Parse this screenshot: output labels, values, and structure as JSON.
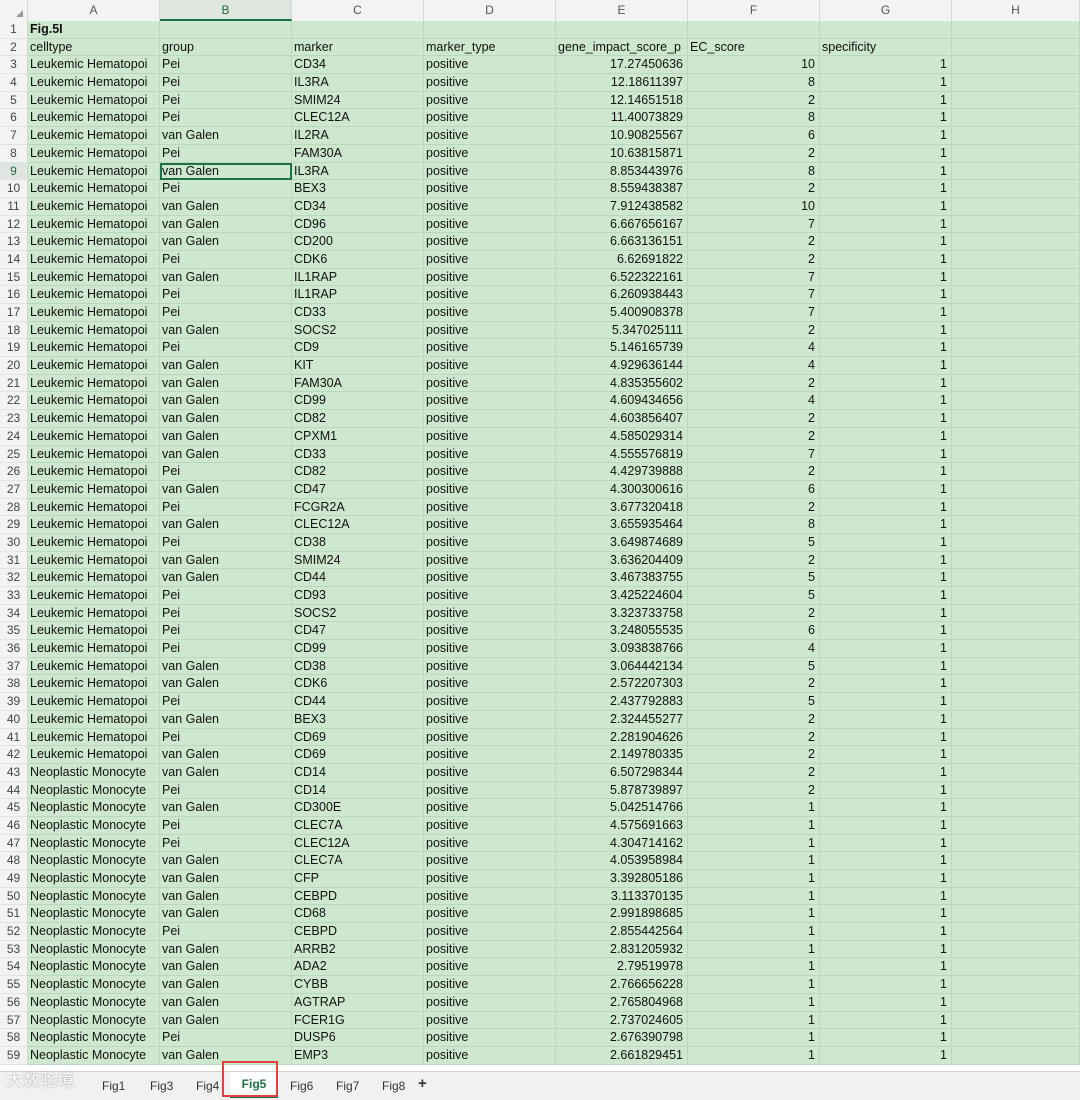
{
  "columns": [
    "A",
    "B",
    "C",
    "D",
    "E",
    "F",
    "G",
    "H"
  ],
  "selected_column": "B",
  "selected_row": "9",
  "title_cell": "Fig.5I",
  "headers": [
    "celltype",
    "group",
    "marker",
    "marker_type",
    "gene_impact_score_p",
    "EC_score",
    "specificity"
  ],
  "rows": [
    [
      "Leukemic Hematopoi",
      "Pei",
      "CD34",
      "positive",
      "17.27450636",
      "10",
      "1"
    ],
    [
      "Leukemic Hematopoi",
      "Pei",
      "IL3RA",
      "positive",
      "12.18611397",
      "8",
      "1"
    ],
    [
      "Leukemic Hematopoi",
      "Pei",
      "SMIM24",
      "positive",
      "12.14651518",
      "2",
      "1"
    ],
    [
      "Leukemic Hematopoi",
      "Pei",
      "CLEC12A",
      "positive",
      "11.40073829",
      "8",
      "1"
    ],
    [
      "Leukemic Hematopoi",
      "van Galen",
      "IL2RA",
      "positive",
      "10.90825567",
      "6",
      "1"
    ],
    [
      "Leukemic Hematopoi",
      "Pei",
      "FAM30A",
      "positive",
      "10.63815871",
      "2",
      "1"
    ],
    [
      "Leukemic Hematopoi",
      "van Galen",
      "IL3RA",
      "positive",
      "8.853443976",
      "8",
      "1"
    ],
    [
      "Leukemic Hematopoi",
      "Pei",
      "BEX3",
      "positive",
      "8.559438387",
      "2",
      "1"
    ],
    [
      "Leukemic Hematopoi",
      "van Galen",
      "CD34",
      "positive",
      "7.912438582",
      "10",
      "1"
    ],
    [
      "Leukemic Hematopoi",
      "van Galen",
      "CD96",
      "positive",
      "6.667656167",
      "7",
      "1"
    ],
    [
      "Leukemic Hematopoi",
      "van Galen",
      "CD200",
      "positive",
      "6.663136151",
      "2",
      "1"
    ],
    [
      "Leukemic Hematopoi",
      "Pei",
      "CDK6",
      "positive",
      "6.62691822",
      "2",
      "1"
    ],
    [
      "Leukemic Hematopoi",
      "van Galen",
      "IL1RAP",
      "positive",
      "6.522322161",
      "7",
      "1"
    ],
    [
      "Leukemic Hematopoi",
      "Pei",
      "IL1RAP",
      "positive",
      "6.260938443",
      "7",
      "1"
    ],
    [
      "Leukemic Hematopoi",
      "Pei",
      "CD33",
      "positive",
      "5.400908378",
      "7",
      "1"
    ],
    [
      "Leukemic Hematopoi",
      "van Galen",
      "SOCS2",
      "positive",
      "5.347025111",
      "2",
      "1"
    ],
    [
      "Leukemic Hematopoi",
      "Pei",
      "CD9",
      "positive",
      "5.146165739",
      "4",
      "1"
    ],
    [
      "Leukemic Hematopoi",
      "van Galen",
      "KIT",
      "positive",
      "4.929636144",
      "4",
      "1"
    ],
    [
      "Leukemic Hematopoi",
      "van Galen",
      "FAM30A",
      "positive",
      "4.835355602",
      "2",
      "1"
    ],
    [
      "Leukemic Hematopoi",
      "van Galen",
      "CD99",
      "positive",
      "4.609434656",
      "4",
      "1"
    ],
    [
      "Leukemic Hematopoi",
      "van Galen",
      "CD82",
      "positive",
      "4.603856407",
      "2",
      "1"
    ],
    [
      "Leukemic Hematopoi",
      "van Galen",
      "CPXM1",
      "positive",
      "4.585029314",
      "2",
      "1"
    ],
    [
      "Leukemic Hematopoi",
      "van Galen",
      "CD33",
      "positive",
      "4.555576819",
      "7",
      "1"
    ],
    [
      "Leukemic Hematopoi",
      "Pei",
      "CD82",
      "positive",
      "4.429739888",
      "2",
      "1"
    ],
    [
      "Leukemic Hematopoi",
      "van Galen",
      "CD47",
      "positive",
      "4.300300616",
      "6",
      "1"
    ],
    [
      "Leukemic Hematopoi",
      "Pei",
      "FCGR2A",
      "positive",
      "3.677320418",
      "2",
      "1"
    ],
    [
      "Leukemic Hematopoi",
      "van Galen",
      "CLEC12A",
      "positive",
      "3.655935464",
      "8",
      "1"
    ],
    [
      "Leukemic Hematopoi",
      "Pei",
      "CD38",
      "positive",
      "3.649874689",
      "5",
      "1"
    ],
    [
      "Leukemic Hematopoi",
      "van Galen",
      "SMIM24",
      "positive",
      "3.636204409",
      "2",
      "1"
    ],
    [
      "Leukemic Hematopoi",
      "van Galen",
      "CD44",
      "positive",
      "3.467383755",
      "5",
      "1"
    ],
    [
      "Leukemic Hematopoi",
      "Pei",
      "CD93",
      "positive",
      "3.425224604",
      "5",
      "1"
    ],
    [
      "Leukemic Hematopoi",
      "Pei",
      "SOCS2",
      "positive",
      "3.323733758",
      "2",
      "1"
    ],
    [
      "Leukemic Hematopoi",
      "Pei",
      "CD47",
      "positive",
      "3.248055535",
      "6",
      "1"
    ],
    [
      "Leukemic Hematopoi",
      "Pei",
      "CD99",
      "positive",
      "3.093838766",
      "4",
      "1"
    ],
    [
      "Leukemic Hematopoi",
      "van Galen",
      "CD38",
      "positive",
      "3.064442134",
      "5",
      "1"
    ],
    [
      "Leukemic Hematopoi",
      "van Galen",
      "CDK6",
      "positive",
      "2.572207303",
      "2",
      "1"
    ],
    [
      "Leukemic Hematopoi",
      "Pei",
      "CD44",
      "positive",
      "2.437792883",
      "5",
      "1"
    ],
    [
      "Leukemic Hematopoi",
      "van Galen",
      "BEX3",
      "positive",
      "2.324455277",
      "2",
      "1"
    ],
    [
      "Leukemic Hematopoi",
      "Pei",
      "CD69",
      "positive",
      "2.281904626",
      "2",
      "1"
    ],
    [
      "Leukemic Hematopoi",
      "van Galen",
      "CD69",
      "positive",
      "2.149780335",
      "2",
      "1"
    ],
    [
      "Neoplastic Monocyte",
      "van Galen",
      "CD14",
      "positive",
      "6.507298344",
      "2",
      "1"
    ],
    [
      "Neoplastic Monocyte",
      "Pei",
      "CD14",
      "positive",
      "5.878739897",
      "2",
      "1"
    ],
    [
      "Neoplastic Monocyte",
      "van Galen",
      "CD300E",
      "positive",
      "5.042514766",
      "1",
      "1"
    ],
    [
      "Neoplastic Monocyte",
      "Pei",
      "CLEC7A",
      "positive",
      "4.575691663",
      "1",
      "1"
    ],
    [
      "Neoplastic Monocyte",
      "Pei",
      "CLEC12A",
      "positive",
      "4.304714162",
      "1",
      "1"
    ],
    [
      "Neoplastic Monocyte",
      "van Galen",
      "CLEC7A",
      "positive",
      "4.053958984",
      "1",
      "1"
    ],
    [
      "Neoplastic Monocyte",
      "van Galen",
      "CFP",
      "positive",
      "3.392805186",
      "1",
      "1"
    ],
    [
      "Neoplastic Monocyte",
      "van Galen",
      "CEBPD",
      "positive",
      "3.113370135",
      "1",
      "1"
    ],
    [
      "Neoplastic Monocyte",
      "van Galen",
      "CD68",
      "positive",
      "2.991898685",
      "1",
      "1"
    ],
    [
      "Neoplastic Monocyte",
      "Pei",
      "CEBPD",
      "positive",
      "2.855442564",
      "1",
      "1"
    ],
    [
      "Neoplastic Monocyte",
      "van Galen",
      "ARRB2",
      "positive",
      "2.831205932",
      "1",
      "1"
    ],
    [
      "Neoplastic Monocyte",
      "van Galen",
      "ADA2",
      "positive",
      "2.79519978",
      "1",
      "1"
    ],
    [
      "Neoplastic Monocyte",
      "van Galen",
      "CYBB",
      "positive",
      "2.766656228",
      "1",
      "1"
    ],
    [
      "Neoplastic Monocyte",
      "van Galen",
      "AGTRAP",
      "positive",
      "2.765804968",
      "1",
      "1"
    ],
    [
      "Neoplastic Monocyte",
      "van Galen",
      "FCER1G",
      "positive",
      "2.737024605",
      "1",
      "1"
    ],
    [
      "Neoplastic Monocyte",
      "Pei",
      "DUSP6",
      "positive",
      "2.676390798",
      "1",
      "1"
    ],
    [
      "Neoplastic Monocyte",
      "van Galen",
      "EMP3",
      "positive",
      "2.661829451",
      "1",
      "1"
    ]
  ],
  "sheet_tabs": [
    "Fig1",
    "Fig3",
    "Fig4",
    "Fig5",
    "Fig6",
    "Fig7",
    "Fig8"
  ],
  "active_tab": "Fig5",
  "add_tab_label": "+",
  "watermark": "大数验境"
}
